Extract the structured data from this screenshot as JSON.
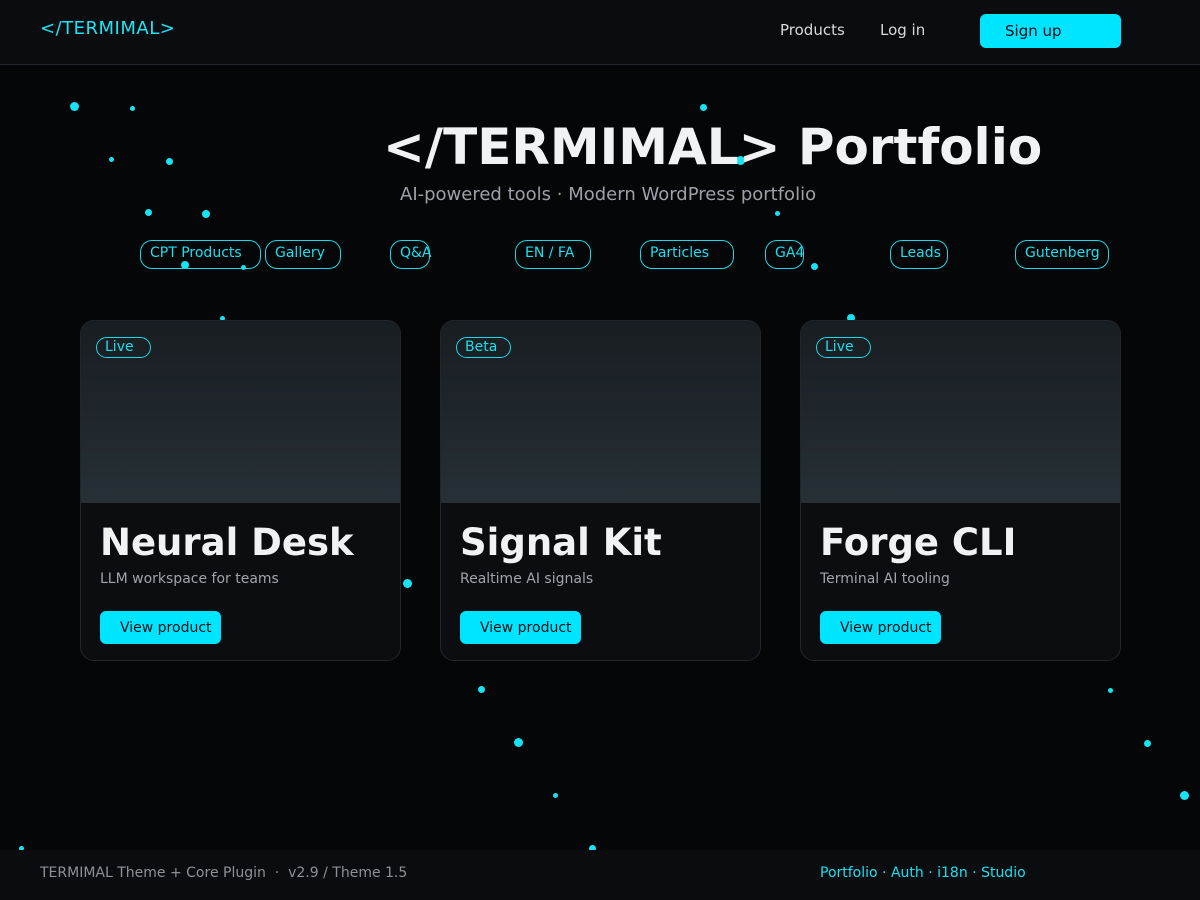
{
  "header": {
    "logo": "</TERMIMAL>",
    "nav": {
      "products": "Products",
      "login": "Log in"
    },
    "signup_label": "Sign up",
    "accent_color": "#00e5ff"
  },
  "hero": {
    "title": "</TERMIMAL> Portfolio",
    "subtitle": "AI-powered tools · Modern WordPress portfolio"
  },
  "features": [
    "CPT Products",
    "Gallery",
    "Q&A",
    "EN / FA",
    "Particles",
    "GA4",
    "Leads",
    "Gutenberg"
  ],
  "products": [
    {
      "badge": "Live",
      "title": "Neural Desk",
      "description": "LLM workspace for teams",
      "button": "View product"
    },
    {
      "badge": "Beta",
      "title": "Signal Kit",
      "description": "Realtime AI signals",
      "button": "View product"
    },
    {
      "badge": "Live",
      "title": "Forge CLI",
      "description": "Terminal AI tooling",
      "button": "View product"
    }
  ],
  "footer": {
    "left": "TERMIMAL Theme + Core Plugin  ·  v2.9 / Theme 1.5",
    "links": [
      "Portfolio",
      "Auth",
      "i18n",
      "Studio"
    ],
    "link_separator": " · "
  }
}
